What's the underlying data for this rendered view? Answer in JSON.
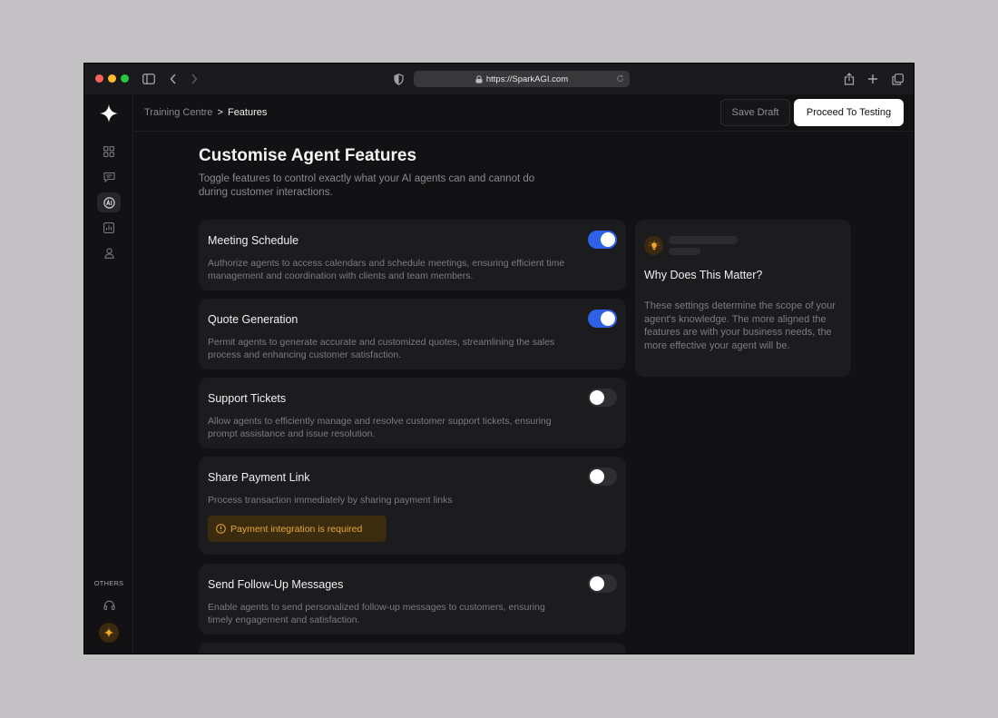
{
  "browser": {
    "url": "https://SparkAGI.com"
  },
  "header": {
    "breadcrumb_parent": "Training Centre",
    "breadcrumb_sep": ">",
    "breadcrumb_current": "Features",
    "save_draft_label": "Save Draft",
    "proceed_label": "Proceed To Testing"
  },
  "sidebar": {
    "section_label": "OTHERS",
    "items": [
      {
        "icon": "grid-icon",
        "active": false
      },
      {
        "icon": "chat-icon",
        "active": false
      },
      {
        "icon": "ai-icon",
        "active": true
      },
      {
        "icon": "chart-icon",
        "active": false
      },
      {
        "icon": "user-icon",
        "active": false
      }
    ],
    "other_items": [
      {
        "icon": "headset-icon"
      },
      {
        "icon": "gear-icon"
      }
    ]
  },
  "main": {
    "title": "Customise Agent Features",
    "subtitle": "Toggle features to control exactly what your AI agents can and cannot do during customer interactions.",
    "features": [
      {
        "title": "Meeting Schedule",
        "description": "Authorize agents to access calendars and schedule meetings, ensuring efficient time management and coordination with clients and team members.",
        "enabled": true
      },
      {
        "title": "Quote Generation",
        "description": "Permit agents to generate accurate and customized quotes, streamlining the sales process and enhancing customer satisfaction.",
        "enabled": true
      },
      {
        "title": "Support Tickets",
        "description": "Allow agents to efficiently manage and resolve customer support tickets, ensuring prompt assistance and issue resolution.",
        "enabled": false
      },
      {
        "title": "Share Payment Link",
        "description": "Process transaction immediately by sharing payment links",
        "enabled": false,
        "warning": "Payment integration is required"
      },
      {
        "title": "Send Follow-Up Messages",
        "description": "Enable agents to send personalized follow-up messages to customers, ensuring timely engagement and satisfaction.",
        "enabled": false
      }
    ]
  },
  "info": {
    "title": "Why Does This Matter?",
    "text": "These settings determine the scope of your agent's knowledge. The more aligned the features are with your business needs, the more effective your agent will be."
  },
  "colors": {
    "accent": "#2f61e6",
    "warning": "#e7a73a",
    "background": "#121214"
  }
}
